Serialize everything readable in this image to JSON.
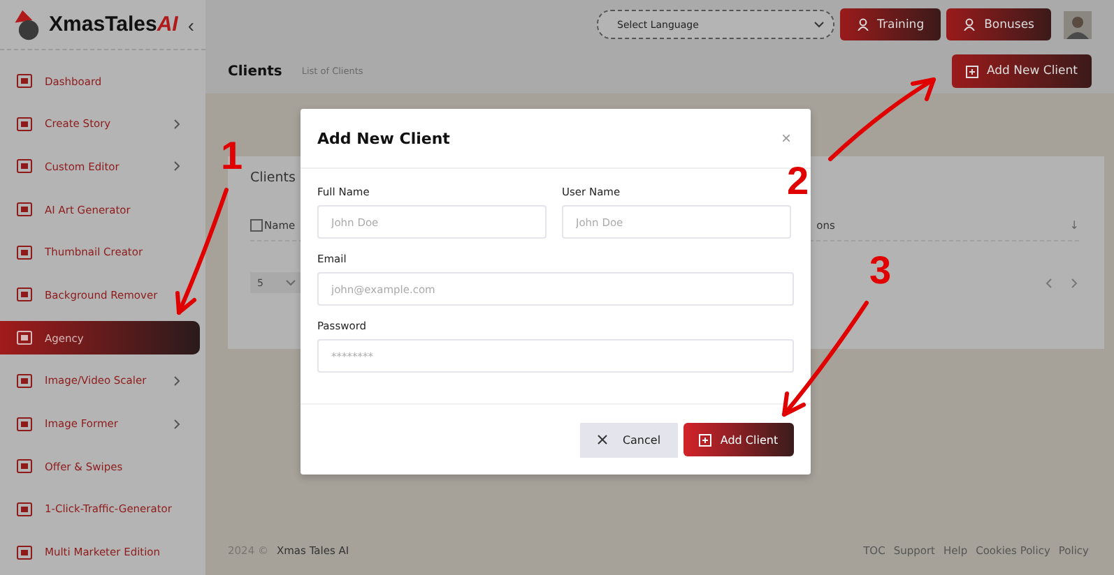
{
  "sidebar": {
    "logo": {
      "text": "XmasTales",
      "accent": "AI"
    },
    "collapse_glyph": "‹",
    "items": [
      {
        "label": "Dashboard",
        "has_submenu": false,
        "selected": false
      },
      {
        "label": "Create Story",
        "has_submenu": true,
        "selected": false
      },
      {
        "label": "Custom Editor",
        "has_submenu": true,
        "selected": false
      },
      {
        "label": "AI Art Generator",
        "has_submenu": false,
        "selected": false
      },
      {
        "label": "Thumbnail Creator",
        "has_submenu": false,
        "selected": false
      },
      {
        "label": "Background Remover",
        "has_submenu": false,
        "selected": false
      },
      {
        "label": "Agency",
        "has_submenu": false,
        "selected": true
      },
      {
        "label": "Image/Video Scaler",
        "has_submenu": true,
        "selected": false
      },
      {
        "label": "Image Former",
        "has_submenu": true,
        "selected": false
      },
      {
        "label": "Offer & Swipes",
        "has_submenu": false,
        "selected": false
      },
      {
        "label": "1-Click-Traffic-Generator",
        "has_submenu": false,
        "selected": false
      },
      {
        "label": "Multi Marketer Edition",
        "has_submenu": false,
        "selected": false
      }
    ]
  },
  "topbar": {
    "language_select": {
      "value": "Select Language"
    },
    "buttons": [
      "Training",
      "Bonuses"
    ]
  },
  "page_header": {
    "title": "Clients",
    "breadcrumb": "List of Clients",
    "action": "Add New Client"
  },
  "card": {
    "title": "Clients",
    "select_all_checked": false,
    "column_1": "Name",
    "column_2": "ons",
    "sort_glyph": "↓",
    "page_size": "5"
  },
  "modal": {
    "title": "Add New Client",
    "close": "×",
    "fields": [
      {
        "label": "Full Name",
        "placeholder": "John Doe"
      },
      {
        "label": "User Name",
        "placeholder": "John Doe"
      },
      {
        "label": "Email",
        "placeholder": "john@example.com"
      },
      {
        "label": "Password",
        "placeholder": "********"
      }
    ],
    "cancel": "Cancel",
    "submit": "Add Client"
  },
  "footer": {
    "year": "2024 ©",
    "brand": "Xmas Tales AI",
    "links": [
      "TOC",
      "Support",
      "Help",
      "Cookies Policy",
      "Policy"
    ]
  },
  "annotations": [
    "1",
    "2",
    "3"
  ]
}
